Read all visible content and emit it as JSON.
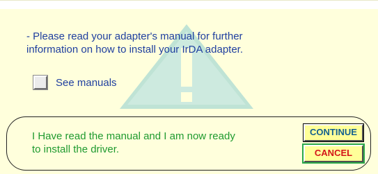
{
  "dialog": {
    "message": "- Please read your adapter's manual for further\ninformation on how to install your IrDA adapter.",
    "checkbox": {
      "label": "See manuals",
      "checked": false
    },
    "confirm_text": "I Have read the manual and I am now ready\nto install the driver.",
    "buttons": {
      "continue_label": "CONTINUE",
      "cancel_label": "CANCEL"
    },
    "watermark_icon": "warning-icon"
  },
  "colors": {
    "background": "#ffffdc",
    "message_text": "#1f3f9f",
    "confirm_text": "#1f9a2f",
    "button_face": "#ffff99",
    "continue_text": "#13608f",
    "cancel_text": "#d41418",
    "cancel_outline": "#2aa84a",
    "watermark": "#bfe3d5"
  }
}
